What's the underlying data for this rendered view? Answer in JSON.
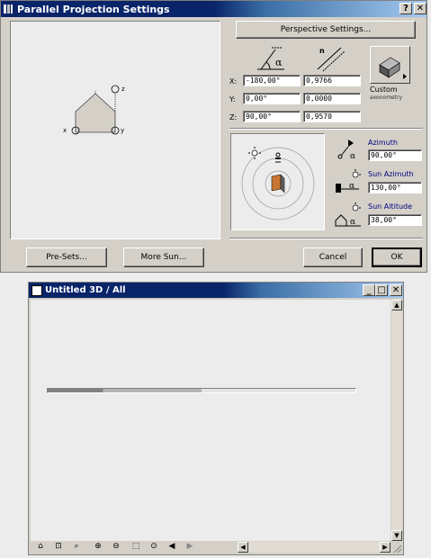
{
  "dialog": {
    "title": "Parallel Projection Settings",
    "help_label": "?",
    "close_label": "✕",
    "perspective_button": "Perspective Settings...",
    "axes": {
      "z": "z",
      "x": "x",
      "y": "y"
    },
    "rows": [
      {
        "label": "X:",
        "angle": "-180,00°",
        "factor": "0,9766"
      },
      {
        "label": "Y:",
        "angle": "0,00°",
        "factor": "0,0000"
      },
      {
        "label": "Z:",
        "angle": "90,00°",
        "factor": "0,9570"
      }
    ],
    "custom_label": "Custom",
    "custom_sub": "axonometry",
    "azimuth_label": "Azimuth",
    "azimuth_value": "90,00°",
    "sun_azimuth_label": "Sun Azimuth",
    "sun_azimuth_value": "130,00°",
    "sun_altitude_label": "Sun Altitude",
    "sun_altitude_value": "38,00°",
    "presets_button": "Pre-Sets...",
    "more_sun_button": "More Sun...",
    "cancel_button": "Cancel",
    "ok_button": "OK"
  },
  "window3d": {
    "title": "Untitled 3D / All",
    "min_label": "_",
    "max_label": "□",
    "close_label": "✕",
    "progress": 0.5
  }
}
